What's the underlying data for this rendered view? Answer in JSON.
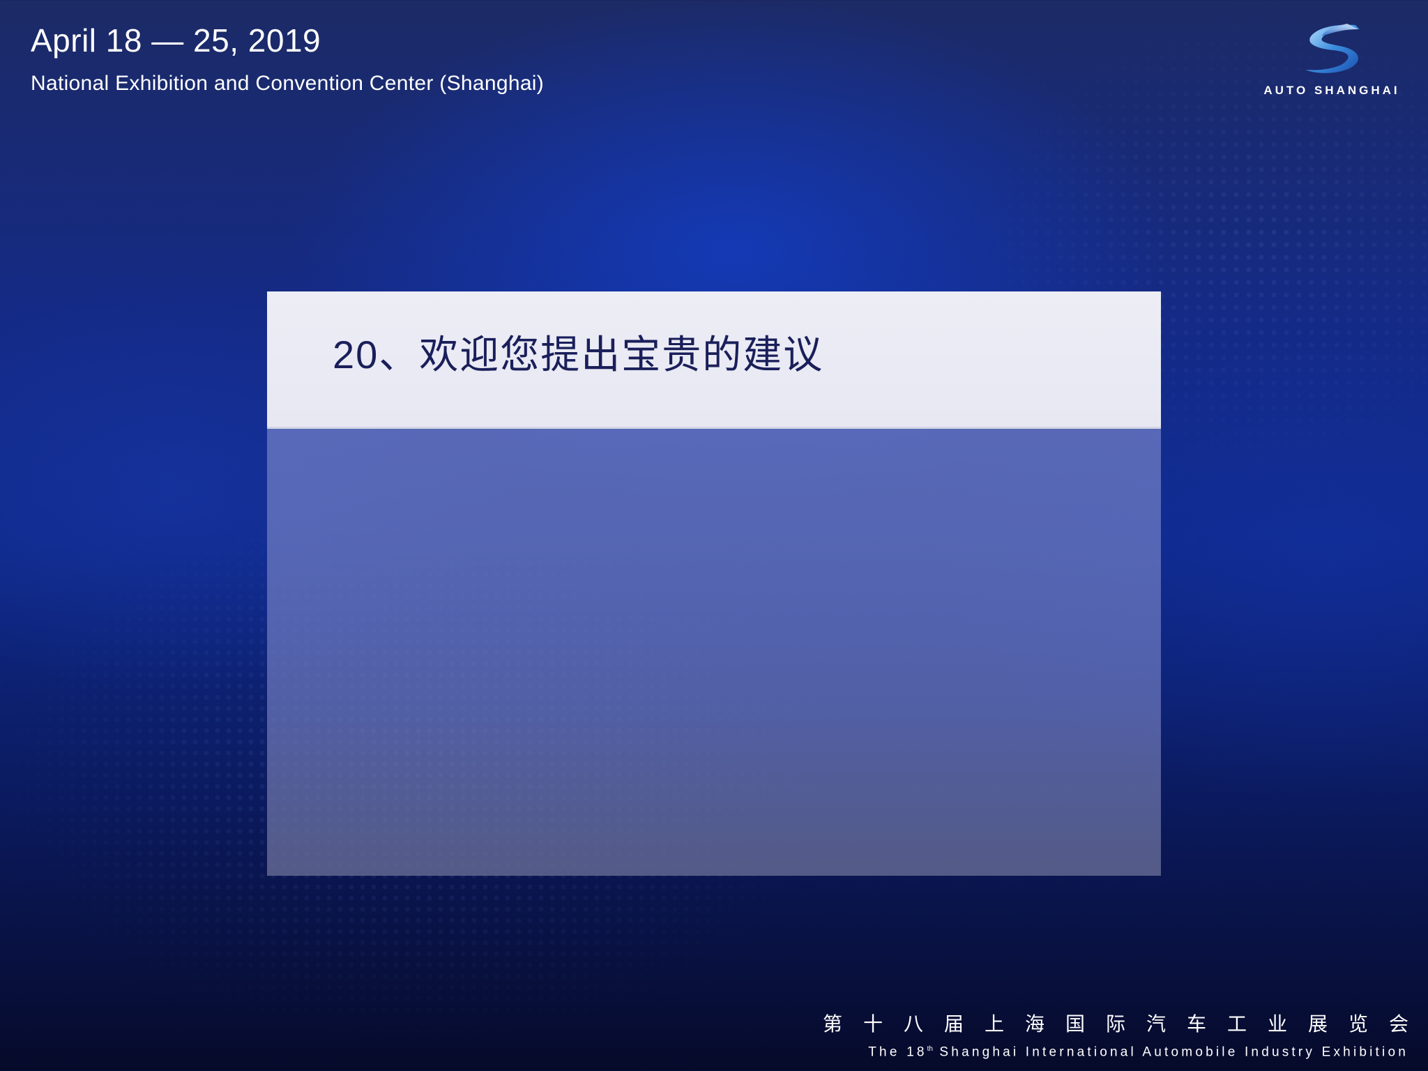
{
  "header": {
    "date": "April 18 — 25, 2019",
    "venue": "National Exhibition and Convention Center (Shanghai)"
  },
  "logo": {
    "icon": "auto-shanghai-s-logo",
    "text": "AUTO SHANGHAI"
  },
  "panel": {
    "title": "20、欢迎您提出宝贵的建议"
  },
  "footer": {
    "chinese": "第十八届上海国际汽车工业展览会",
    "english_prefix": "The 18",
    "english_ordinal": "th",
    "english_suffix": " Shanghai International Automobile Industry Exhibition"
  },
  "colors": {
    "background_top": "#1c2a66",
    "background_mid": "#0f2a8a",
    "background_bottom": "#060a2a",
    "panel_header": "#ecedf5",
    "panel_body": "#6e7ac0",
    "title_text": "#1a1f5a",
    "logo_blue": "#3a8dde"
  }
}
